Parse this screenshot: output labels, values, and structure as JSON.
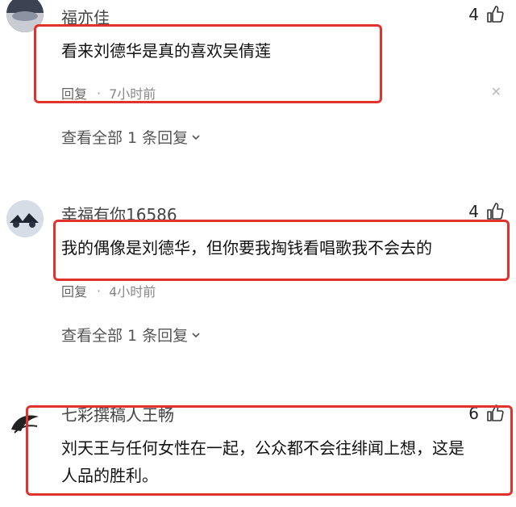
{
  "comments": [
    {
      "username": "福亦佳",
      "likes": "4",
      "content": "看来刘德华是真的喜欢吴倩莲",
      "reply_label": "回复",
      "separator": "·",
      "time": "7小时前",
      "view_replies": "查看全部 1 条回复"
    },
    {
      "username": "幸福有你16586",
      "likes": "4",
      "content": "我的偶像是刘德华，但你要我掏钱看唱歌我不会去的",
      "reply_label": "回复",
      "separator": "·",
      "time": "4小时前",
      "view_replies": "查看全部 1 条回复"
    },
    {
      "username": "七彩撰稿人王畅",
      "likes": "6",
      "content_line1": "刘天王与任何女性在一起，公众都不会往绯闻上想，这是",
      "content_line2": "人品的胜利。"
    }
  ],
  "icons": {
    "like": "thumbs-up-icon",
    "close": "close-icon",
    "chevron": "chevron-down-icon"
  },
  "colors": {
    "highlight": "#e0332e"
  }
}
